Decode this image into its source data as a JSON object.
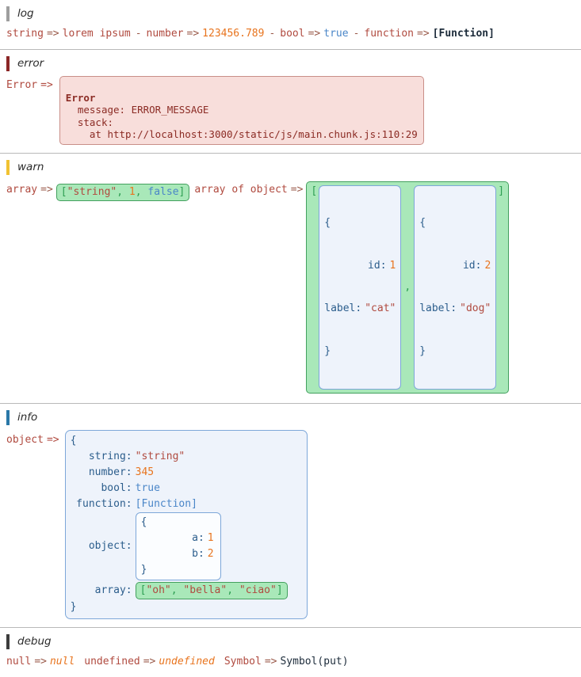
{
  "sections": [
    {
      "level": "log",
      "accent": "#9e9e9e",
      "entries": [
        {
          "label": "string",
          "arrow": "=>",
          "value": "lorem ipsum",
          "kind": "string"
        },
        {
          "label": "number",
          "arrow": "=>",
          "value": "123456.789",
          "kind": "number"
        },
        {
          "label": "bool",
          "arrow": "=>",
          "value": "true",
          "kind": "bool"
        },
        {
          "label": "function",
          "arrow": "=>",
          "value": "[Function]",
          "kind": "function"
        }
      ],
      "separator": "-"
    },
    {
      "level": "error",
      "accent": "#8b2626",
      "error": {
        "label": "Error",
        "arrow": "=>",
        "title": "Error",
        "lines": [
          "  message: ERROR_MESSAGE",
          "  stack:",
          "    at http://localhost:3000/static/js/main.chunk.js:110:29"
        ]
      }
    },
    {
      "level": "warn",
      "accent": "#f1c232",
      "array_entry": {
        "label": "array",
        "arrow": "=>",
        "open": "[",
        "close": "]",
        "items": [
          {
            "text": "\"string\"",
            "kind": "string"
          },
          {
            "text": "1",
            "kind": "number"
          },
          {
            "text": "false",
            "kind": "bool"
          }
        ],
        "comma": ","
      },
      "array_of_object_entry": {
        "label": "array of object",
        "arrow": "=>",
        "open": "[",
        "close": "]",
        "comma": ",",
        "objects": [
          {
            "open": "{",
            "close": "}",
            "pairs": [
              {
                "key": "id:",
                "value": "1",
                "kind": "number"
              },
              {
                "key": "label:",
                "value": "\"cat\"",
                "kind": "string"
              }
            ]
          },
          {
            "open": "{",
            "close": "}",
            "pairs": [
              {
                "key": "id:",
                "value": "2",
                "kind": "number"
              },
              {
                "key": "label:",
                "value": "\"dog\"",
                "kind": "string"
              }
            ]
          }
        ]
      }
    },
    {
      "level": "info",
      "accent": "#2a78a8",
      "object_entry": {
        "label": "object",
        "arrow": "=>",
        "open": "{",
        "close": "}",
        "pairs": [
          {
            "key": "string:",
            "value": "\"string\"",
            "kind": "string"
          },
          {
            "key": "number:",
            "value": "345",
            "kind": "number"
          },
          {
            "key": "bool:",
            "value": "true",
            "kind": "bool"
          },
          {
            "key": "function:",
            "value": "[Function]",
            "kind": "bool"
          }
        ],
        "nested_object": {
          "key": "object:",
          "open": "{",
          "close": "}",
          "pairs": [
            {
              "key": "a:",
              "value": "1",
              "kind": "number"
            },
            {
              "key": "b:",
              "value": "2",
              "kind": "number"
            }
          ]
        },
        "nested_array": {
          "key": "array:",
          "open": "[",
          "close": "]",
          "comma": ",",
          "items": [
            {
              "text": "\"oh\"",
              "kind": "string"
            },
            {
              "text": "\"bella\"",
              "kind": "string"
            },
            {
              "text": "\"ciao\"",
              "kind": "string"
            }
          ]
        }
      }
    },
    {
      "level": "debug",
      "accent": "#3c3c3c",
      "entries": [
        {
          "label": "null",
          "arrow": "=>",
          "value": "null",
          "kind": "nullish"
        },
        {
          "label": "undefined",
          "arrow": "=>",
          "value": "undefined",
          "kind": "nullish"
        },
        {
          "label": "Symbol",
          "arrow": "=>",
          "value": "Symbol(put)",
          "kind": "symbol"
        }
      ],
      "separator": " "
    }
  ]
}
